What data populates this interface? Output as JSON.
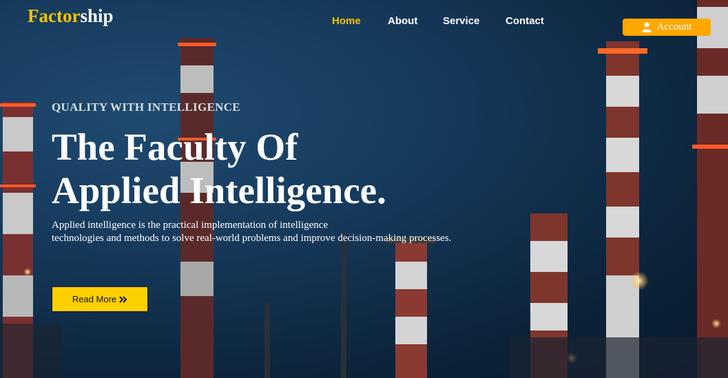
{
  "brand": {
    "part1": "Factor",
    "part2": "ship"
  },
  "nav": {
    "home": "Home",
    "about": "About",
    "service": "Service",
    "contact": "Contact"
  },
  "account": {
    "label": "Account",
    "icon": "user-icon"
  },
  "hero": {
    "eyebrow": "QUALITY WITH INTELLIGENCE",
    "title_line1": "The Faculty Of",
    "title_line2": "Applied Intelligence.",
    "description_line1": "Applied intelligence is the practical implementation of intelligence",
    "description_line2": "technologies and methods to solve real-world problems and improve decision-making processes.",
    "cta_label": "Read More",
    "cta_icon": "double-chevron-right-icon"
  },
  "colors": {
    "accent": "#f5c400",
    "account_bg": "#ffa800",
    "cta_bg": "#ffd000",
    "bg_dark": "#0c2238"
  }
}
